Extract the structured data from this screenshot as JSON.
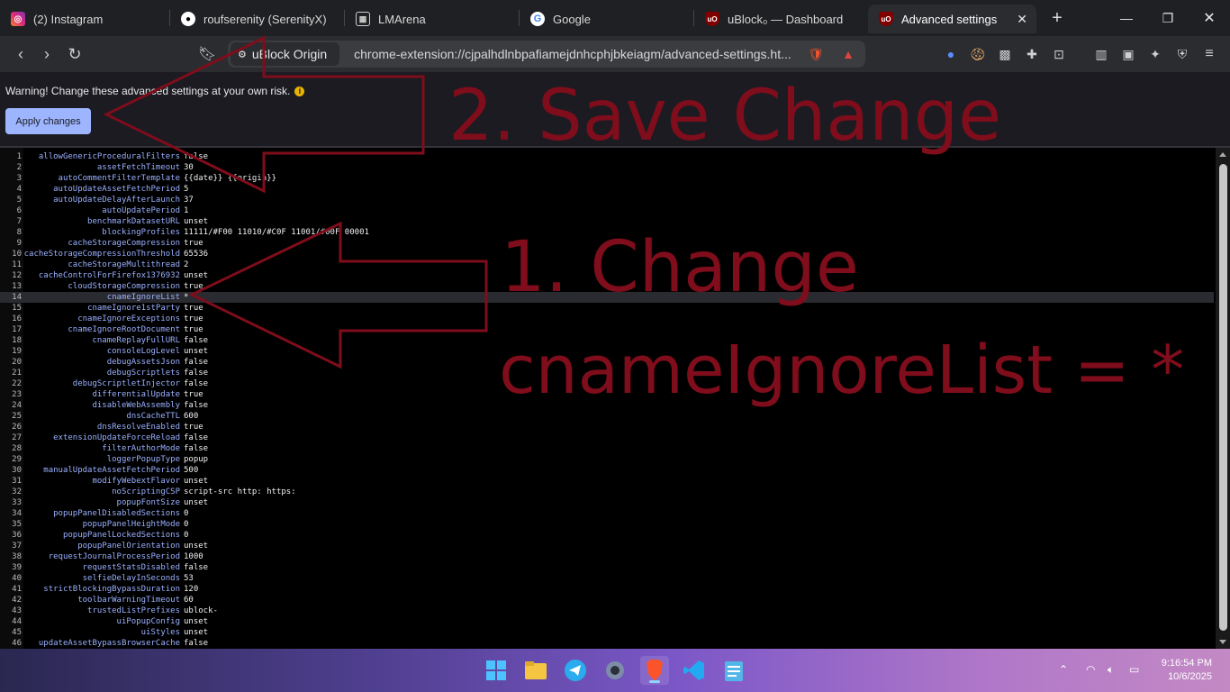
{
  "tabs": [
    {
      "title": "(2) Instagram",
      "icon": "instagram-icon",
      "color": "#d6249f"
    },
    {
      "title": "roufserenity (SerenityX)",
      "icon": "github-icon",
      "color": "#ffffff"
    },
    {
      "title": "LMArena",
      "icon": "grid-icon",
      "color": "#cfcfcf"
    },
    {
      "title": "Google",
      "icon": "google-icon",
      "color": "#4285f4"
    },
    {
      "title": "uBlock₀ — Dashboard",
      "icon": "ublock-icon",
      "color": "#800000"
    },
    {
      "title": "Advanced settings",
      "icon": "ublock-icon",
      "color": "#800000",
      "active": true
    }
  ],
  "toolbar": {
    "site_name": "uBlock Origin",
    "url": "chrome-extension://cjpalhdlnbpafiamejdnhcphjbkeiagm/advanced-settings.ht..."
  },
  "page": {
    "warning": "Warning! Change these advanced settings at your own risk.",
    "apply_label": "Apply changes"
  },
  "settings": [
    {
      "n": "1",
      "k": "allowGenericProceduralFilters",
      "v": "false"
    },
    {
      "n": "2",
      "k": "assetFetchTimeout",
      "v": "30"
    },
    {
      "n": "3",
      "k": "autoCommentFilterTemplate",
      "v": "{{date}} {{origin}}"
    },
    {
      "n": "4",
      "k": "autoUpdateAssetFetchPeriod",
      "v": "5"
    },
    {
      "n": "5",
      "k": "autoUpdateDelayAfterLaunch",
      "v": "37"
    },
    {
      "n": "6",
      "k": "autoUpdatePeriod",
      "v": "1"
    },
    {
      "n": "7",
      "k": "benchmarkDatasetURL",
      "v": "unset"
    },
    {
      "n": "8",
      "k": "blockingProfiles",
      "v": "11111/#F00 11010/#C0F 11001/#00F 00001"
    },
    {
      "n": "9",
      "k": "cacheStorageCompression",
      "v": "true"
    },
    {
      "n": "10",
      "k": "cacheStorageCompressionThreshold",
      "v": "65536"
    },
    {
      "n": "11",
      "k": "cacheStorageMultithread",
      "v": "2"
    },
    {
      "n": "12",
      "k": "cacheControlForFirefox1376932",
      "v": "unset"
    },
    {
      "n": "13",
      "k": "cloudStorageCompression",
      "v": "true"
    },
    {
      "n": "14",
      "k": "cnameIgnoreList",
      "v": "*",
      "highlight": true
    },
    {
      "n": "15",
      "k": "cnameIgnore1stParty",
      "v": "true"
    },
    {
      "n": "16",
      "k": "cnameIgnoreExceptions",
      "v": "true"
    },
    {
      "n": "17",
      "k": "cnameIgnoreRootDocument",
      "v": "true"
    },
    {
      "n": "18",
      "k": "cnameReplayFullURL",
      "v": "false"
    },
    {
      "n": "19",
      "k": "consoleLogLevel",
      "v": "unset"
    },
    {
      "n": "20",
      "k": "debugAssetsJson",
      "v": "false"
    },
    {
      "n": "21",
      "k": "debugScriptlets",
      "v": "false"
    },
    {
      "n": "22",
      "k": "debugScriptletInjector",
      "v": "false"
    },
    {
      "n": "23",
      "k": "differentialUpdate",
      "v": "true"
    },
    {
      "n": "24",
      "k": "disableWebAssembly",
      "v": "false"
    },
    {
      "n": "25",
      "k": "dnsCacheTTL",
      "v": "600"
    },
    {
      "n": "26",
      "k": "dnsResolveEnabled",
      "v": "true"
    },
    {
      "n": "27",
      "k": "extensionUpdateForceReload",
      "v": "false"
    },
    {
      "n": "28",
      "k": "filterAuthorMode",
      "v": "false"
    },
    {
      "n": "29",
      "k": "loggerPopupType",
      "v": "popup"
    },
    {
      "n": "30",
      "k": "manualUpdateAssetFetchPeriod",
      "v": "500"
    },
    {
      "n": "31",
      "k": "modifyWebextFlavor",
      "v": "unset"
    },
    {
      "n": "32",
      "k": "noScriptingCSP",
      "v": "script-src http: https:"
    },
    {
      "n": "33",
      "k": "popupFontSize",
      "v": "unset"
    },
    {
      "n": "34",
      "k": "popupPanelDisabledSections",
      "v": "0"
    },
    {
      "n": "35",
      "k": "popupPanelHeightMode",
      "v": "0"
    },
    {
      "n": "36",
      "k": "popupPanelLockedSections",
      "v": "0"
    },
    {
      "n": "37",
      "k": "popupPanelOrientation",
      "v": "unset"
    },
    {
      "n": "38",
      "k": "requestJournalProcessPeriod",
      "v": "1000"
    },
    {
      "n": "39",
      "k": "requestStatsDisabled",
      "v": "false"
    },
    {
      "n": "40",
      "k": "selfieDelayInSeconds",
      "v": "53"
    },
    {
      "n": "41",
      "k": "strictBlockingBypassDuration",
      "v": "120"
    },
    {
      "n": "42",
      "k": "toolbarWarningTimeout",
      "v": "60"
    },
    {
      "n": "43",
      "k": "trustedListPrefixes",
      "v": "ublock-"
    },
    {
      "n": "44",
      "k": "uiPopupConfig",
      "v": "unset"
    },
    {
      "n": "45",
      "k": "uiStyles",
      "v": "unset"
    },
    {
      "n": "46",
      "k": "updateAssetBypassBrowserCache",
      "v": "false"
    }
  ],
  "annotations": {
    "step2": "2. Save Change",
    "step1_line1": "1. Change",
    "step1_line2": "cnameIgnoreList = *",
    "color": "#7f0d1b"
  },
  "taskbar": {
    "apps": [
      "windows-start-icon",
      "file-explorer-icon",
      "telegram-icon",
      "settings-icon",
      "brave-icon",
      "vscode-icon",
      "notepad-icon"
    ],
    "time": "9:16:54 PM",
    "date": "10/6/2025"
  }
}
